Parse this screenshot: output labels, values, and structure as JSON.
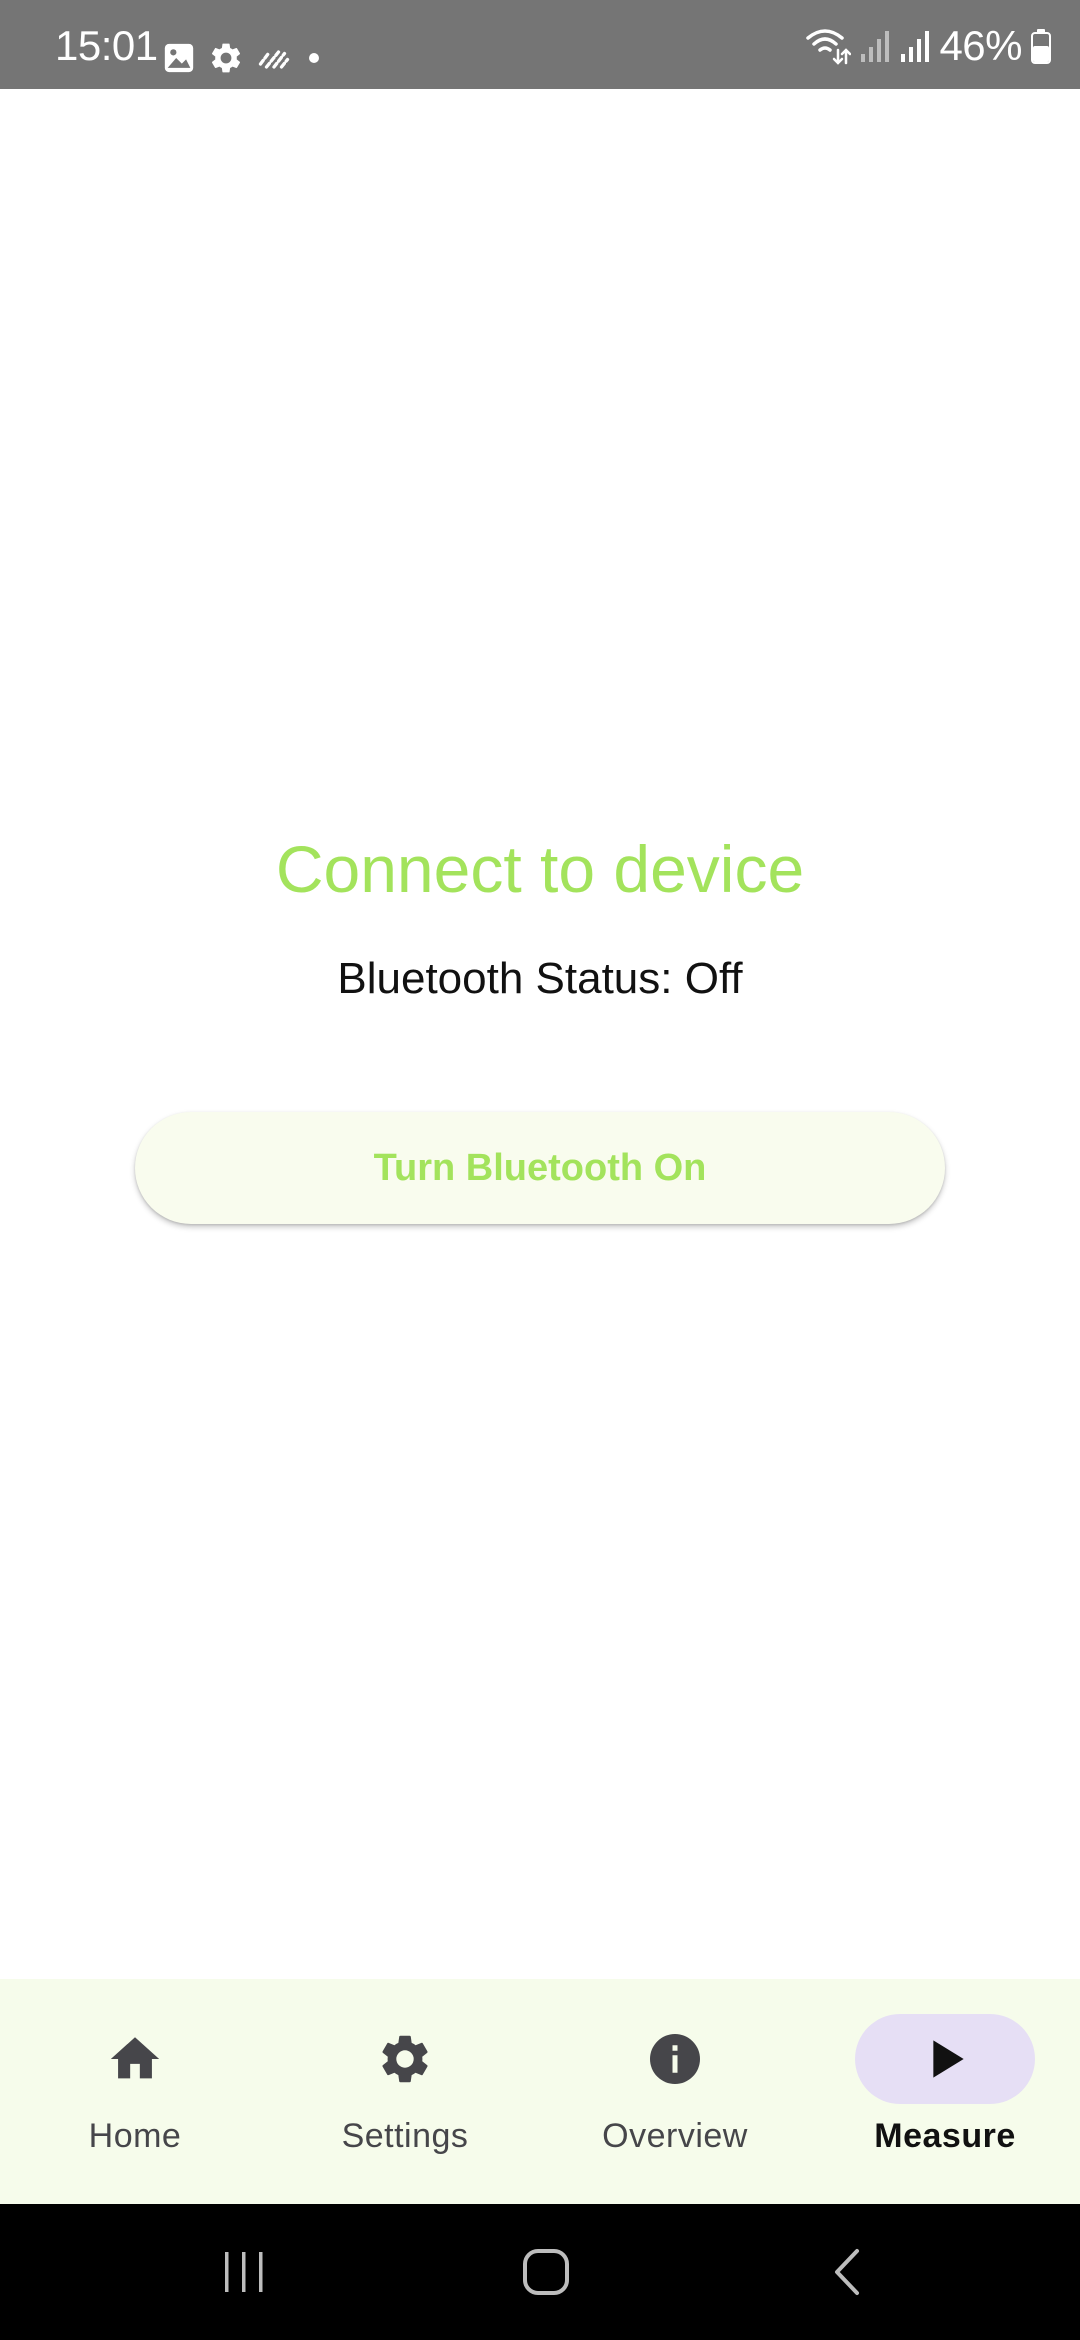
{
  "status_bar": {
    "time": "15:01",
    "battery_percent": "46%",
    "icons_left": [
      "image-icon",
      "gear-icon",
      "activity-icon",
      "dot-icon"
    ],
    "icons_right": [
      "wifi-icon",
      "signal-icon-sim1",
      "signal-icon-sim2",
      "battery-icon"
    ]
  },
  "main": {
    "title": "Connect to device",
    "bluetooth_status": "Bluetooth Status: Off",
    "button_label": "Turn Bluetooth On"
  },
  "bottom_nav": {
    "items": [
      {
        "label": "Home",
        "icon": "home-icon",
        "active": false
      },
      {
        "label": "Settings",
        "icon": "gear-icon",
        "active": false
      },
      {
        "label": "Overview",
        "icon": "info-icon",
        "active": false
      },
      {
        "label": "Measure",
        "icon": "play-icon",
        "active": true
      }
    ]
  },
  "system_nav": {
    "buttons": [
      "recents-icon",
      "home-outline-icon",
      "back-icon"
    ]
  },
  "colors": {
    "accent_green": "#a3e35c",
    "status_bar": "#757575",
    "nav_background": "#f6fceb",
    "nav_active_indicator": "#e6dff5",
    "button_background": "#f9fcee"
  }
}
